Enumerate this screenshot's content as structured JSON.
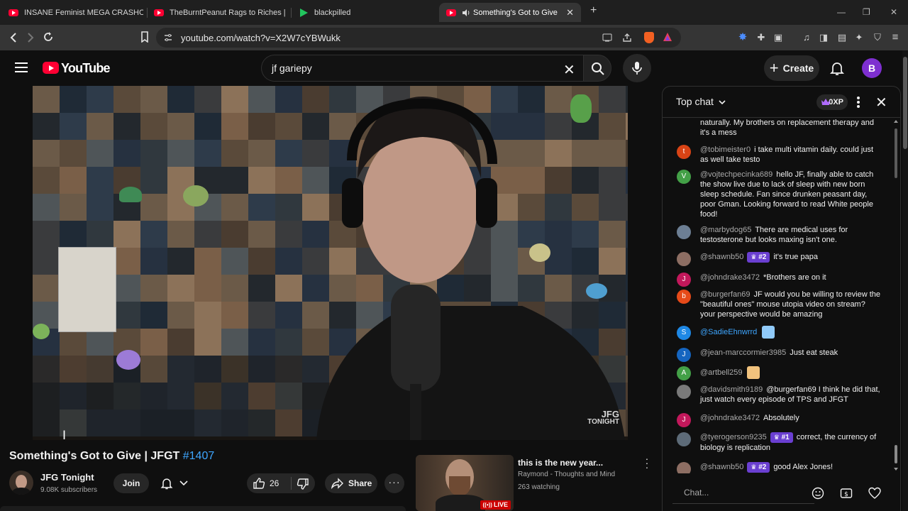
{
  "browser": {
    "tabs": [
      {
        "title": "INSANE Feminist MEGA CRASHOUT",
        "icon": "youtube-icon"
      },
      {
        "title": "TheBurntPeanut Rags to Riches | ARC",
        "icon": "youtube-icon"
      },
      {
        "title": "blackpilled",
        "icon": "rumble-icon"
      },
      {
        "title": "Something's Got to Give | JFG",
        "icon": "youtube-icon",
        "active": true
      }
    ],
    "url": "youtube.com/watch?v=X2W7cYBWukk"
  },
  "header": {
    "logo_text": "YouTube",
    "search_value": "jf gariepy",
    "create_label": "Create",
    "avatar_letter": "B"
  },
  "video": {
    "watermark_line1": "JFG",
    "watermark_line2": "TONIGHT",
    "title": "Something's Got to Give | JFGT ",
    "hashtag": "#1407"
  },
  "channel": {
    "name": "JFG Tonight",
    "subscribers": "9.08K subscribers",
    "join_label": "Join",
    "likes": "26",
    "share_label": "Share"
  },
  "recommended": {
    "title": "this is the new year...",
    "channel": "Raymond - Thoughts and Mind",
    "watching": "263 watching",
    "live_badge": "LIVE"
  },
  "chat": {
    "mode_label": "Top chat",
    "xp_label": "0XP",
    "input_placeholder": "Chat...",
    "messages": [
      {
        "author": "",
        "text": "naturally. My brothers on replacement therapy and it's a mess",
        "avatar": "",
        "avatar_color": "#c2185b"
      },
      {
        "author": "@tobimeister0",
        "text": "i take multi vitamin daily. could just as well take testo",
        "avatar": "t",
        "avatar_color": "#d84315"
      },
      {
        "author": "@vojtechpecinka689",
        "text": "hello JF, finally able to catch the show live due to lack of sleep with new born sleep schedule. Fan since drunken peasant day, poor Gman. Looking forward to read White people food!",
        "avatar": "V",
        "avatar_color": "#43a047"
      },
      {
        "author": "@marbydog65",
        "text": "There are medical uses for testosterone but looks maxing isn't one.",
        "avatar": "",
        "avatar_color": "#6d7f94"
      },
      {
        "author": "@shawnb50",
        "badge": "#2",
        "text": "it's true papa",
        "avatar": "",
        "avatar_color": "#8d6e63"
      },
      {
        "author": "@johndrake3472",
        "text": "*Brothers are on it",
        "avatar": "J",
        "avatar_color": "#c2185b"
      },
      {
        "author": "@burgerfan69",
        "text": "JF would you be willing to review the \"beautiful ones\" mouse utopia video on stream? your perspective would be amazing",
        "avatar": "b",
        "avatar_color": "#e64a19"
      },
      {
        "author": "@SadieEhnwrrd",
        "text": "",
        "avatar": "S",
        "avatar_color": "#1e88e5",
        "author_style": "blue",
        "emoji_color": "#90caf9"
      },
      {
        "author": "@jean-marccormier3985",
        "text": "Just eat steak",
        "avatar": "J",
        "avatar_color": "#1565c0"
      },
      {
        "author": "@artbell259",
        "text": "",
        "avatar": "A",
        "avatar_color": "#43a047",
        "emoji_color": "#f1c27d"
      },
      {
        "author": "@davidsmith9189",
        "text": "@burgerfan69 I think he did that, just watch every episode of TPS and JFGT",
        "avatar": "",
        "avatar_color": "#7a7a7a"
      },
      {
        "author": "@johndrake3472",
        "text": "Absolutely",
        "avatar": "J",
        "avatar_color": "#c2185b"
      },
      {
        "author": "@tyerogerson9235",
        "badge": "#1",
        "text": "correct, the currency of biology is replication",
        "avatar": "",
        "avatar_color": "#5d6b78"
      },
      {
        "author": "@shawnb50",
        "badge": "#2",
        "text": "good Alex Jones!",
        "avatar": "",
        "avatar_color": "#8d6e63"
      }
    ]
  },
  "colors": {
    "accent_red": "#ff0033",
    "link_blue": "#3ea6ff",
    "badge_purple": "#6a3fd1",
    "avatar_purple": "#7e2fd0"
  }
}
